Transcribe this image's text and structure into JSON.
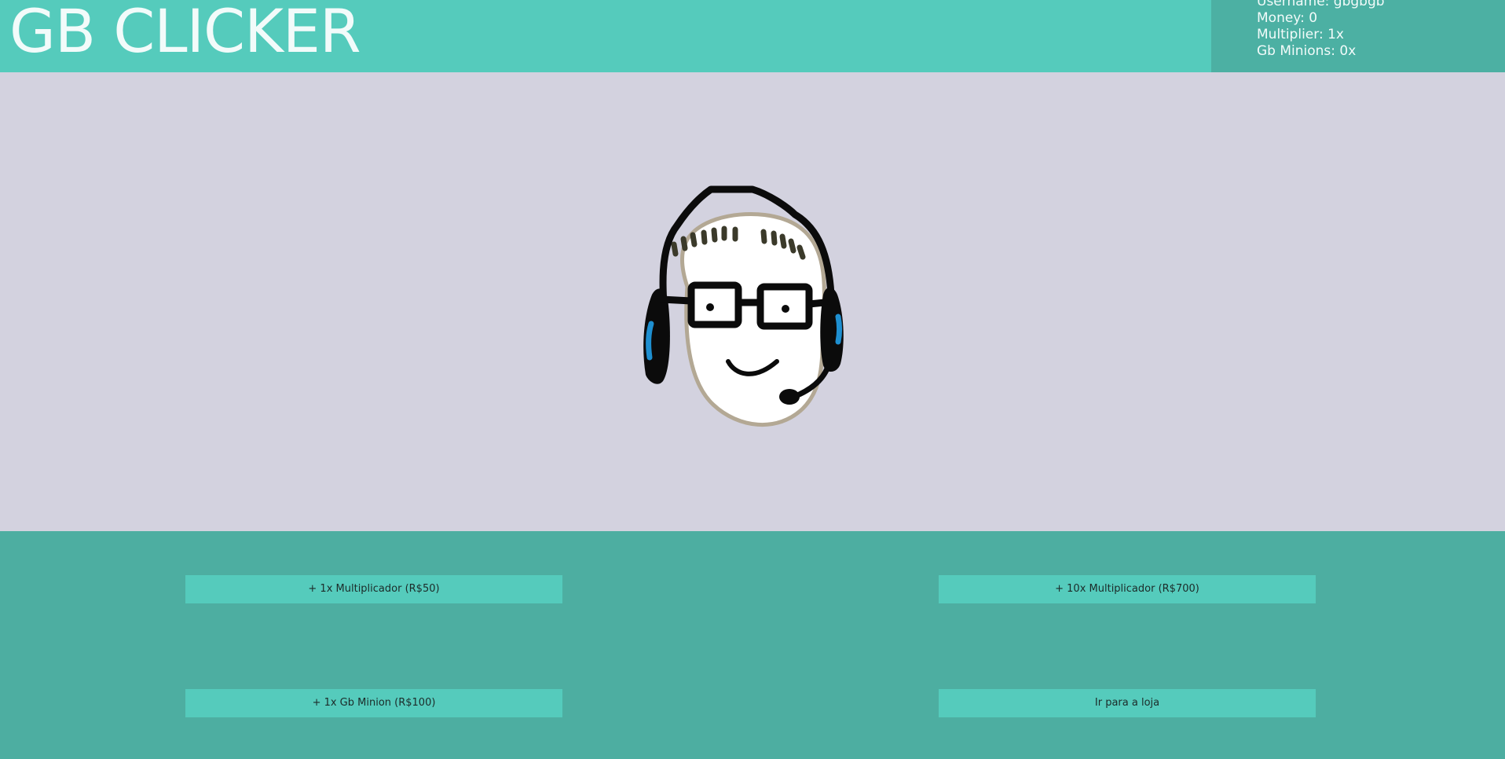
{
  "header": {
    "title": "GB CLICKER"
  },
  "stats": {
    "username": "Username: gbgbgb",
    "money": "Money: 0",
    "multiplier": "Multiplier: 1x",
    "minions": "Gb Minions: 0x"
  },
  "avatar": {
    "icon": "headset-face-icon"
  },
  "actions": {
    "multiplier_1": "+ 1x Multiplicador (R$50)",
    "multiplier_10": "+ 10x Multiplicador (R$700)",
    "minion_1": "+ 1x Gb Minion (R$100)",
    "shop": "Ir para a loja"
  },
  "colors": {
    "header_bg": "#55cbbc",
    "stats_bg": "#4cb0a3",
    "play_bg": "#d3d2df",
    "controls_bg": "#4daea1",
    "button_bg": "#55cbbc",
    "headset_accent": "#1e8fd0"
  }
}
